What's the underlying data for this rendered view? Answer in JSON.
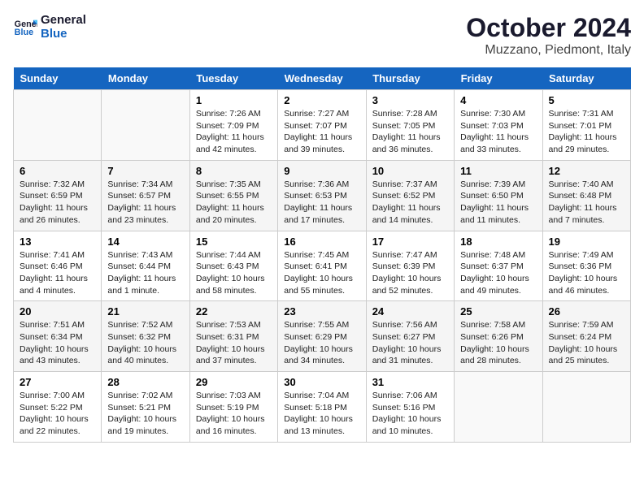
{
  "logo": {
    "line1": "General",
    "line2": "Blue"
  },
  "title": "October 2024",
  "subtitle": "Muzzano, Piedmont, Italy",
  "days_of_week": [
    "Sunday",
    "Monday",
    "Tuesday",
    "Wednesday",
    "Thursday",
    "Friday",
    "Saturday"
  ],
  "weeks": [
    [
      {
        "day": "",
        "info": ""
      },
      {
        "day": "",
        "info": ""
      },
      {
        "day": "1",
        "info": "Sunrise: 7:26 AM\nSunset: 7:09 PM\nDaylight: 11 hours and 42 minutes."
      },
      {
        "day": "2",
        "info": "Sunrise: 7:27 AM\nSunset: 7:07 PM\nDaylight: 11 hours and 39 minutes."
      },
      {
        "day": "3",
        "info": "Sunrise: 7:28 AM\nSunset: 7:05 PM\nDaylight: 11 hours and 36 minutes."
      },
      {
        "day": "4",
        "info": "Sunrise: 7:30 AM\nSunset: 7:03 PM\nDaylight: 11 hours and 33 minutes."
      },
      {
        "day": "5",
        "info": "Sunrise: 7:31 AM\nSunset: 7:01 PM\nDaylight: 11 hours and 29 minutes."
      }
    ],
    [
      {
        "day": "6",
        "info": "Sunrise: 7:32 AM\nSunset: 6:59 PM\nDaylight: 11 hours and 26 minutes."
      },
      {
        "day": "7",
        "info": "Sunrise: 7:34 AM\nSunset: 6:57 PM\nDaylight: 11 hours and 23 minutes."
      },
      {
        "day": "8",
        "info": "Sunrise: 7:35 AM\nSunset: 6:55 PM\nDaylight: 11 hours and 20 minutes."
      },
      {
        "day": "9",
        "info": "Sunrise: 7:36 AM\nSunset: 6:53 PM\nDaylight: 11 hours and 17 minutes."
      },
      {
        "day": "10",
        "info": "Sunrise: 7:37 AM\nSunset: 6:52 PM\nDaylight: 11 hours and 14 minutes."
      },
      {
        "day": "11",
        "info": "Sunrise: 7:39 AM\nSunset: 6:50 PM\nDaylight: 11 hours and 11 minutes."
      },
      {
        "day": "12",
        "info": "Sunrise: 7:40 AM\nSunset: 6:48 PM\nDaylight: 11 hours and 7 minutes."
      }
    ],
    [
      {
        "day": "13",
        "info": "Sunrise: 7:41 AM\nSunset: 6:46 PM\nDaylight: 11 hours and 4 minutes."
      },
      {
        "day": "14",
        "info": "Sunrise: 7:43 AM\nSunset: 6:44 PM\nDaylight: 11 hours and 1 minute."
      },
      {
        "day": "15",
        "info": "Sunrise: 7:44 AM\nSunset: 6:43 PM\nDaylight: 10 hours and 58 minutes."
      },
      {
        "day": "16",
        "info": "Sunrise: 7:45 AM\nSunset: 6:41 PM\nDaylight: 10 hours and 55 minutes."
      },
      {
        "day": "17",
        "info": "Sunrise: 7:47 AM\nSunset: 6:39 PM\nDaylight: 10 hours and 52 minutes."
      },
      {
        "day": "18",
        "info": "Sunrise: 7:48 AM\nSunset: 6:37 PM\nDaylight: 10 hours and 49 minutes."
      },
      {
        "day": "19",
        "info": "Sunrise: 7:49 AM\nSunset: 6:36 PM\nDaylight: 10 hours and 46 minutes."
      }
    ],
    [
      {
        "day": "20",
        "info": "Sunrise: 7:51 AM\nSunset: 6:34 PM\nDaylight: 10 hours and 43 minutes."
      },
      {
        "day": "21",
        "info": "Sunrise: 7:52 AM\nSunset: 6:32 PM\nDaylight: 10 hours and 40 minutes."
      },
      {
        "day": "22",
        "info": "Sunrise: 7:53 AM\nSunset: 6:31 PM\nDaylight: 10 hours and 37 minutes."
      },
      {
        "day": "23",
        "info": "Sunrise: 7:55 AM\nSunset: 6:29 PM\nDaylight: 10 hours and 34 minutes."
      },
      {
        "day": "24",
        "info": "Sunrise: 7:56 AM\nSunset: 6:27 PM\nDaylight: 10 hours and 31 minutes."
      },
      {
        "day": "25",
        "info": "Sunrise: 7:58 AM\nSunset: 6:26 PM\nDaylight: 10 hours and 28 minutes."
      },
      {
        "day": "26",
        "info": "Sunrise: 7:59 AM\nSunset: 6:24 PM\nDaylight: 10 hours and 25 minutes."
      }
    ],
    [
      {
        "day": "27",
        "info": "Sunrise: 7:00 AM\nSunset: 5:22 PM\nDaylight: 10 hours and 22 minutes."
      },
      {
        "day": "28",
        "info": "Sunrise: 7:02 AM\nSunset: 5:21 PM\nDaylight: 10 hours and 19 minutes."
      },
      {
        "day": "29",
        "info": "Sunrise: 7:03 AM\nSunset: 5:19 PM\nDaylight: 10 hours and 16 minutes."
      },
      {
        "day": "30",
        "info": "Sunrise: 7:04 AM\nSunset: 5:18 PM\nDaylight: 10 hours and 13 minutes."
      },
      {
        "day": "31",
        "info": "Sunrise: 7:06 AM\nSunset: 5:16 PM\nDaylight: 10 hours and 10 minutes."
      },
      {
        "day": "",
        "info": ""
      },
      {
        "day": "",
        "info": ""
      }
    ]
  ]
}
